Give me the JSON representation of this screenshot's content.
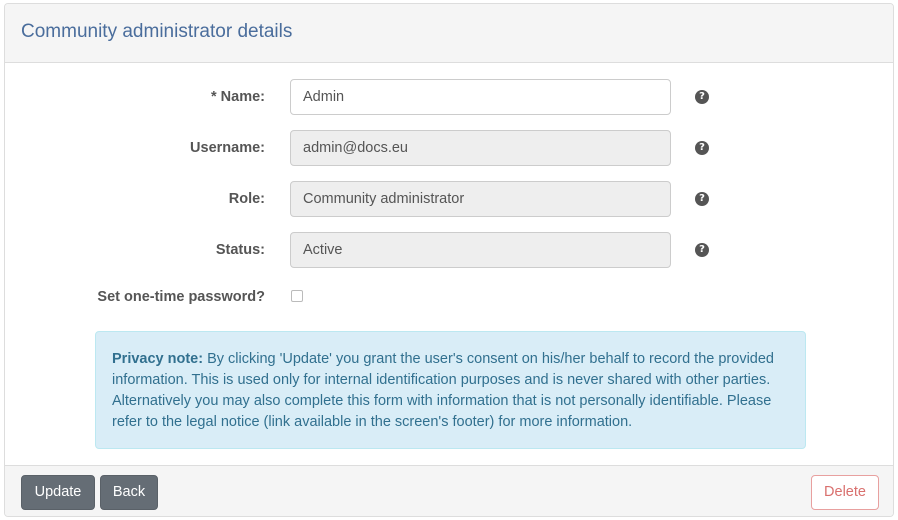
{
  "panel": {
    "title": "Community administrator details"
  },
  "form": {
    "name": {
      "label": "* Name:",
      "value": "Admin",
      "help": "?"
    },
    "username": {
      "label": "Username:",
      "value": "admin@docs.eu",
      "help": "?"
    },
    "role": {
      "label": "Role:",
      "value": "Community administrator",
      "help": "?"
    },
    "status": {
      "label": "Status:",
      "value": "Active",
      "help": "?"
    },
    "otp": {
      "label": "Set one-time password?",
      "checked": false
    }
  },
  "privacy": {
    "title": "Privacy note:",
    "text": " By clicking 'Update' you grant the user's consent on his/her behalf to record the provided information. This is used only for internal identification purposes and is never shared with other parties. Alternatively you may also complete this form with information that is not personally identifiable. Please refer to the legal notice (link available in the screen's footer) for more information."
  },
  "footer": {
    "update_label": "Update",
    "back_label": "Back",
    "delete_label": "Delete"
  },
  "colors": {
    "title": "#4a6d9c",
    "alert_bg": "#d9edf7",
    "alert_text": "#31708f",
    "button_dark": "#656d75",
    "danger": "#d9706e"
  }
}
